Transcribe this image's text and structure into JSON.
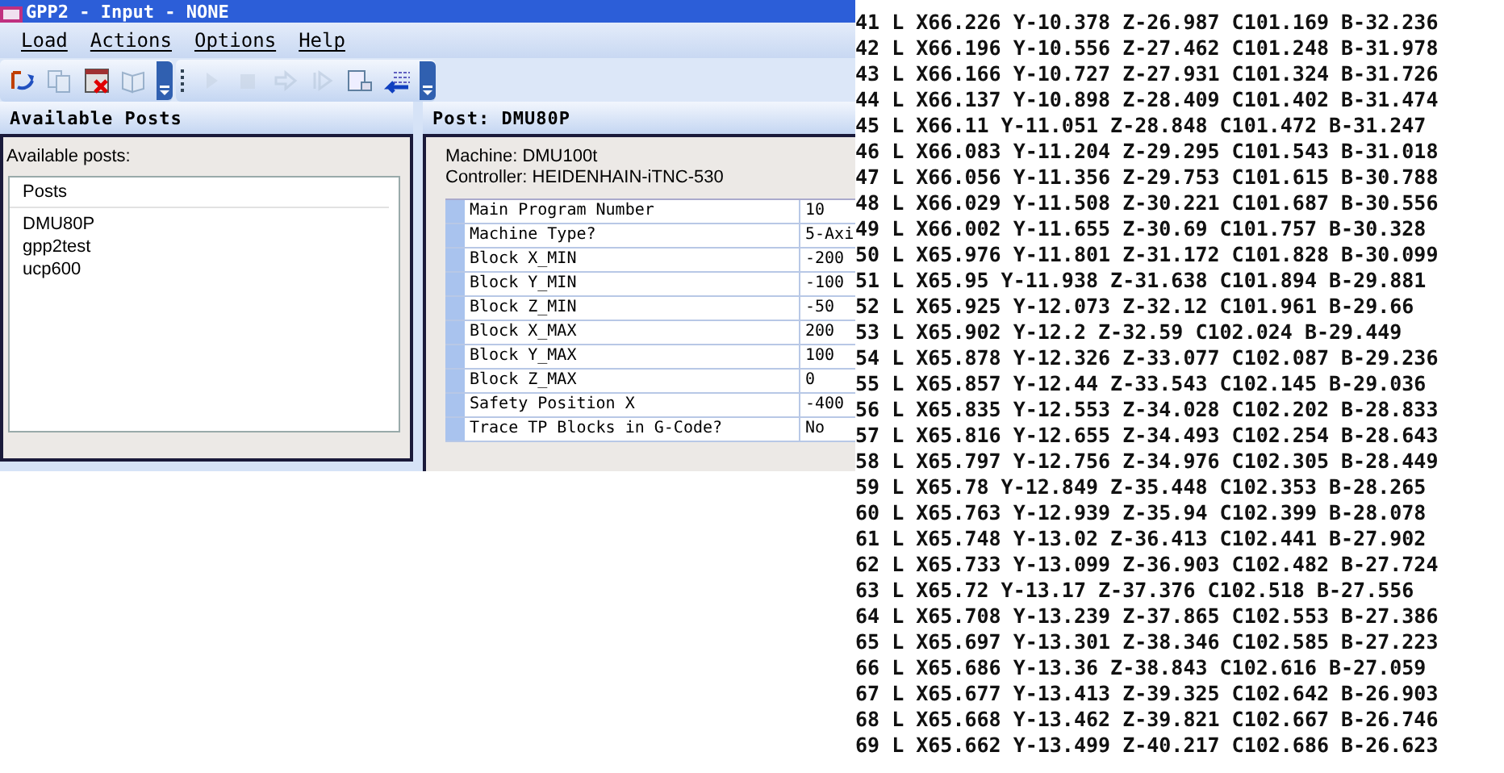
{
  "window": {
    "title": "GPP2 - Input - NONE"
  },
  "menu": [
    {
      "label": "Load"
    },
    {
      "label": "Actions"
    },
    {
      "label": "Options"
    },
    {
      "label": "Help"
    }
  ],
  "toolbar": {
    "groups": [
      {
        "buttons": [
          {
            "kind": "refresh",
            "disabled": false
          },
          {
            "kind": "copy",
            "disabled": true
          },
          {
            "kind": "delete",
            "disabled": false
          },
          {
            "kind": "book",
            "disabled": true
          }
        ]
      },
      {
        "buttons": [
          {
            "kind": "play",
            "disabled": true
          },
          {
            "kind": "stop",
            "disabled": true
          },
          {
            "kind": "step",
            "disabled": true
          },
          {
            "kind": "next",
            "disabled": true
          },
          {
            "kind": "table",
            "disabled": false
          },
          {
            "kind": "transfer",
            "disabled": false
          }
        ]
      }
    ]
  },
  "posts_panel": {
    "title": "Available Posts",
    "label": "Available posts:",
    "list_header": "Posts",
    "items": [
      {
        "label": "DMU80P"
      },
      {
        "label": "gpp2test"
      },
      {
        "label": "ucp600"
      }
    ]
  },
  "post_panel": {
    "title": "Post: DMU80P",
    "machine": "Machine: DMU100t",
    "controller": "Controller: HEIDENHAIN-iTNC-530",
    "properties": [
      {
        "name": "Main Program Number",
        "value": "10"
      },
      {
        "name": "Machine Type?",
        "value": "5-Axi"
      },
      {
        "name": "Block X_MIN",
        "value": "-200"
      },
      {
        "name": "Block Y_MIN",
        "value": "-100"
      },
      {
        "name": "Block Z_MIN",
        "value": "-50"
      },
      {
        "name": "Block X_MAX",
        "value": "200"
      },
      {
        "name": "Block Y_MAX",
        "value": "100"
      },
      {
        "name": "Block Z_MAX",
        "value": "0"
      },
      {
        "name": "Safety Position X",
        "value": "-400"
      },
      {
        "name": "Trace TP Blocks in G-Code?",
        "value": "No"
      }
    ]
  },
  "listing": {
    "lines": [
      "41 L X66.226 Y-10.378 Z-26.987 C101.169 B-32.236",
      "42 L X66.196 Y-10.556 Z-27.462 C101.248 B-31.978",
      "43 L X66.166 Y-10.727 Z-27.931 C101.324 B-31.726",
      "44 L X66.137 Y-10.898 Z-28.409 C101.402 B-31.474",
      "45 L X66.11 Y-11.051 Z-28.848 C101.472 B-31.247",
      "46 L X66.083 Y-11.204 Z-29.295 C101.543 B-31.018",
      "47 L X66.056 Y-11.356 Z-29.753 C101.615 B-30.788",
      "48 L X66.029 Y-11.508 Z-30.221 C101.687 B-30.556",
      "49 L X66.002 Y-11.655 Z-30.69 C101.757 B-30.328",
      "50 L X65.976 Y-11.801 Z-31.172 C101.828 B-30.099",
      "51 L X65.95 Y-11.938 Z-31.638 C101.894 B-29.881",
      "52 L X65.925 Y-12.073 Z-32.12 C101.961 B-29.66",
      "53 L X65.902 Y-12.2 Z-32.59 C102.024 B-29.449",
      "54 L X65.878 Y-12.326 Z-33.077 C102.087 B-29.236",
      "55 L X65.857 Y-12.44 Z-33.543 C102.145 B-29.036",
      "56 L X65.835 Y-12.553 Z-34.028 C102.202 B-28.833",
      "57 L X65.816 Y-12.655 Z-34.493 C102.254 B-28.643",
      "58 L X65.797 Y-12.756 Z-34.976 C102.305 B-28.449",
      "59 L X65.78 Y-12.849 Z-35.448 C102.353 B-28.265",
      "60 L X65.763 Y-12.939 Z-35.94 C102.399 B-28.078",
      "61 L X65.748 Y-13.02 Z-36.413 C102.441 B-27.902",
      "62 L X65.733 Y-13.099 Z-36.903 C102.482 B-27.724",
      "63 L X65.72 Y-13.17 Z-37.376 C102.518 B-27.556",
      "64 L X65.708 Y-13.239 Z-37.865 C102.553 B-27.386",
      "65 L X65.697 Y-13.301 Z-38.346 C102.585 B-27.223",
      "66 L X65.686 Y-13.36 Z-38.843 C102.616 B-27.059",
      "67 L X65.677 Y-13.413 Z-39.325 C102.642 B-26.903",
      "68 L X65.668 Y-13.462 Z-39.821 C102.667 B-26.746",
      "69 L X65.662 Y-13.499 Z-40.217 C102.686 B-26.623"
    ]
  }
}
